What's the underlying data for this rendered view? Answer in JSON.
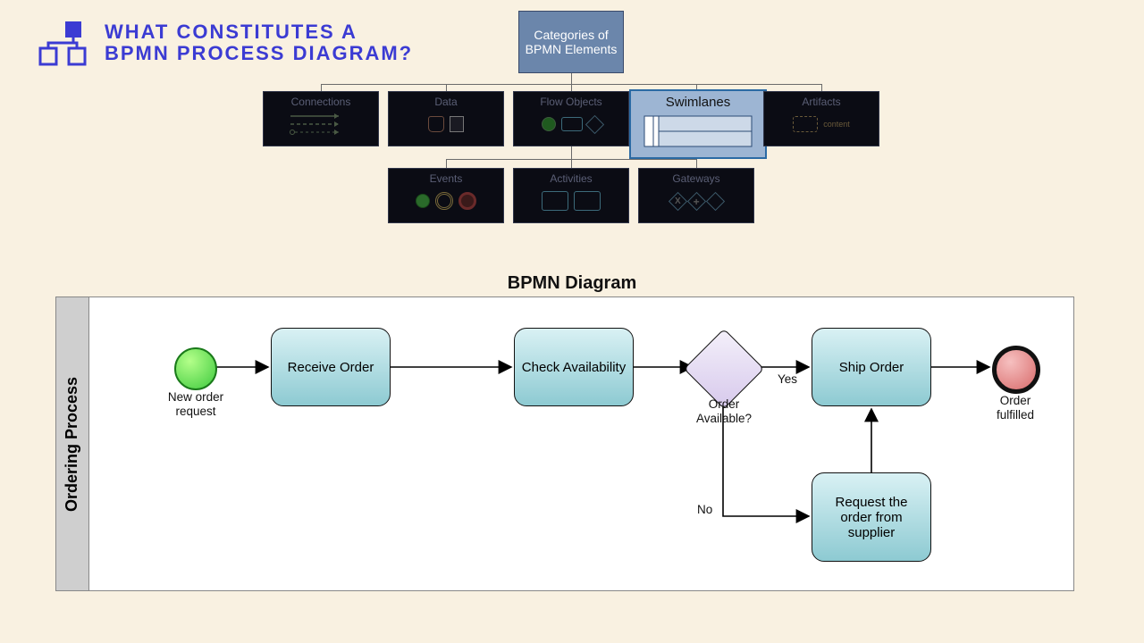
{
  "title": {
    "line1": "WHAT CONSTITUTES A",
    "line2": "BPMN PROCESS DIAGRAM?"
  },
  "hierarchy": {
    "root": "Categories of BPMN Elements",
    "row1": [
      {
        "label": "Connections"
      },
      {
        "label": "Data"
      },
      {
        "label": "Flow Objects"
      },
      {
        "label": "Swimlanes"
      },
      {
        "label": "Artifacts"
      }
    ],
    "row2": [
      {
        "label": "Events"
      },
      {
        "label": "Activities"
      },
      {
        "label": "Gateways"
      }
    ]
  },
  "bpmn": {
    "diagramTitle": "BPMN Diagram",
    "laneTitle": "Ordering Process",
    "startLabel": "New order request",
    "endLabel": "Order fulfilled",
    "tasks": {
      "receive": "Receive Order",
      "check": "Check Availability",
      "ship": "Ship Order",
      "request": "Request the order from supplier"
    },
    "gatewayLabel": "Order Available?",
    "edges": {
      "yes": "Yes",
      "no": "No"
    }
  }
}
